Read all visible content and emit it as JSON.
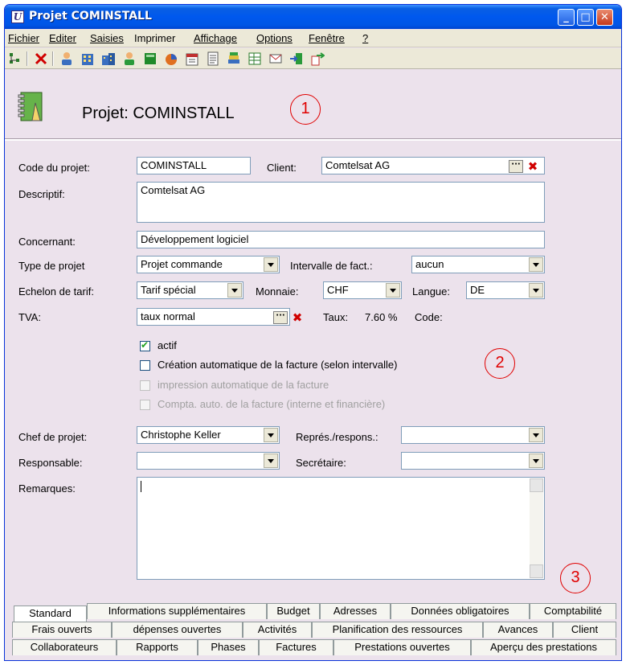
{
  "window": {
    "title": "Projet COMINSTALL",
    "app_icon": "U"
  },
  "menu": [
    {
      "label": "Fichier"
    },
    {
      "label": "Editer"
    },
    {
      "label": "Saisies"
    },
    {
      "label": "Imprimer"
    },
    {
      "label": "Affichage"
    },
    {
      "label": "Options"
    },
    {
      "label": "Fenêtre"
    },
    {
      "label": "?"
    }
  ],
  "toolbar_icons": [
    "tree-icon",
    "delete-icon",
    "person-icon",
    "building-icon",
    "buildings-icon",
    "person-green-icon",
    "green-box-icon",
    "chart-icon",
    "calendar-icon",
    "document-icon",
    "stack-icon",
    "table-icon",
    "mail-icon",
    "export-icon",
    "import-icon"
  ],
  "header": {
    "title": "Projet: COMINSTALL"
  },
  "markers": [
    "1",
    "2",
    "3"
  ],
  "form": {
    "code_label": "Code du projet:",
    "code_value": "COMINSTALL",
    "client_label": "Client:",
    "client_value": "Comtelsat AG",
    "descriptif_label": "Descriptif:",
    "descriptif_value": "Comtelsat AG",
    "concernant_label": "Concernant:",
    "concernant_value": "Développement logiciel",
    "type_label": "Type de projet",
    "type_value": "Projet commande",
    "intervalle_label": "Intervalle de fact.:",
    "intervalle_value": "aucun",
    "echelon_label": "Echelon de tarif:",
    "echelon_value": "Tarif spécial",
    "monnaie_label": "Monnaie:",
    "monnaie_value": "CHF",
    "langue_label": "Langue:",
    "langue_value": "DE",
    "tva_label": "TVA:",
    "tva_value": "taux normal",
    "taux_label": "Taux:",
    "taux_value": "7.60 %",
    "code2_label": "Code:",
    "chk_actif": "actif",
    "chk_creation": "Création automatique de la facture (selon intervalle)",
    "chk_impression": "impression automatique de la facture",
    "chk_compta": "Compta. auto. de la facture (interne et financière)",
    "chef_label": "Chef de projet:",
    "chef_value": "Christophe Keller",
    "repres_label": "Représ./respons.:",
    "repres_value": "",
    "responsable_label": "Responsable:",
    "responsable_value": "",
    "secretaire_label": "Secrétaire:",
    "secretaire_value": "",
    "remarques_label": "Remarques:"
  },
  "tabs": {
    "row1": [
      "Standard",
      "Informations supplémentaires",
      "Budget",
      "Adresses",
      "Données obligatoires",
      "Comptabilité"
    ],
    "row2": [
      "Frais ouverts",
      "dépenses ouvertes",
      "Activités",
      "Planification des ressources",
      "Avances",
      "Client"
    ],
    "row3": [
      "Collaborateurs",
      "Rapports",
      "Phases",
      "Factures",
      "Prestations ouvertes",
      "Aperçu des prestations"
    ]
  }
}
